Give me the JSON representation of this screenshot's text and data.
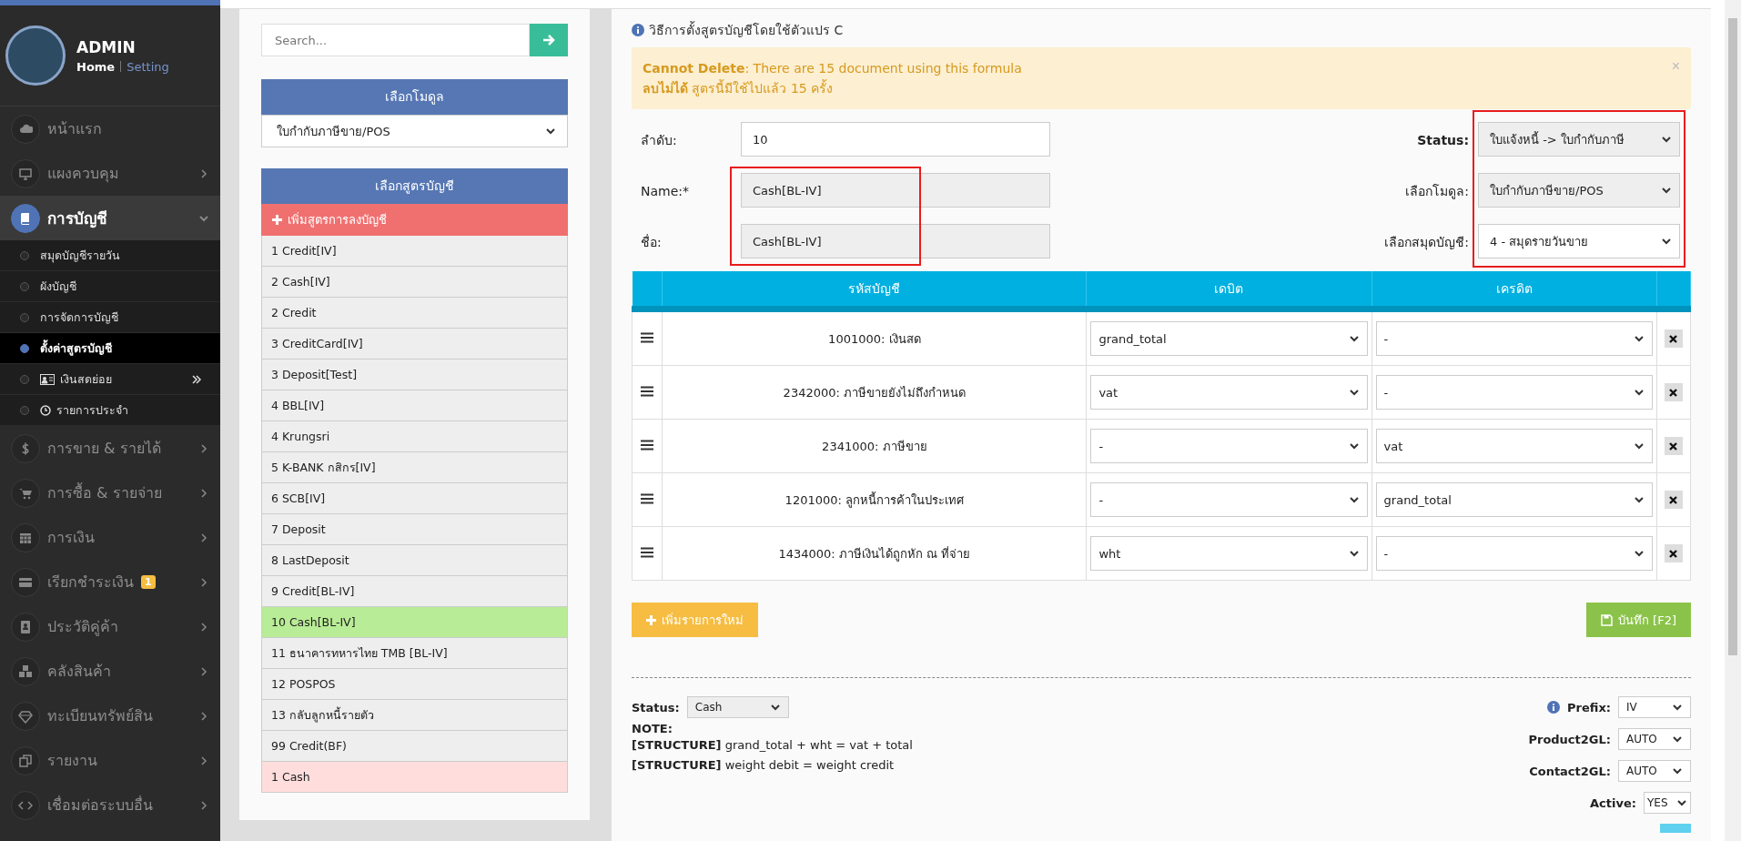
{
  "sidebar": {
    "user": {
      "name": "ADMIN",
      "links": [
        {
          "label": "Home",
          "selected": true
        },
        {
          "label": "Setting",
          "selected": false
        }
      ]
    },
    "items": [
      {
        "label": "หน้าแรก",
        "selected": false,
        "has_arrow": false
      },
      {
        "label": "แผงควบคุม",
        "expanded": false,
        "selected": false,
        "has_arrow": true
      },
      {
        "label": "การบัญชี",
        "expanded": true,
        "selected": true,
        "has_arrow": true,
        "children": [
          {
            "label": "สมุดบัญชีรายวัน",
            "selected": false
          },
          {
            "label": "ผังบัญชี",
            "selected": false
          },
          {
            "label": "การจัดการบัญชี",
            "selected": false
          },
          {
            "label": "ตั้งค่าสูตรบัญชี",
            "selected": true
          },
          {
            "label": "เงินสดย่อย",
            "selected": false
          },
          {
            "label": "รายการประจำ",
            "selected": false
          }
        ]
      },
      {
        "label": "การขาย & รายได้",
        "expanded": false,
        "selected": false,
        "has_arrow": true
      },
      {
        "label": "การซื้อ & รายจ่าย",
        "expanded": false,
        "selected": false,
        "has_arrow": true
      },
      {
        "label": "การเงิน",
        "expanded": false,
        "selected": false,
        "has_arrow": true
      },
      {
        "label": "เรียกชำระเงิน",
        "expanded": false,
        "selected": false,
        "has_arrow": true,
        "badge": "1"
      },
      {
        "label": "ประวัติคู่ค้า",
        "expanded": false,
        "selected": false,
        "has_arrow": true
      },
      {
        "label": "คลังสินค้า",
        "expanded": false,
        "selected": false,
        "has_arrow": true
      },
      {
        "label": "ทะเบียนทรัพย์สิน",
        "expanded": false,
        "selected": false,
        "has_arrow": true
      },
      {
        "label": "รายงาน",
        "expanded": false,
        "selected": false,
        "has_arrow": true
      },
      {
        "label": "เชื่อมต่อระบบอื่น",
        "expanded": false,
        "selected": false,
        "has_arrow": true
      }
    ]
  },
  "formula_panel": {
    "search": {
      "placeholder": "Search..."
    },
    "module": {
      "header": "เลือกโมดูล",
      "value": "ใบกำกับภาษีขาย/POS"
    },
    "formulas": {
      "header": "เลือกสูตรบัญชี",
      "add_button": "เพิ่มสูตรการลงบัญชี",
      "items": [
        {
          "label": "1 Credit[IV]",
          "selected": false,
          "kind": "saved"
        },
        {
          "label": "2 Cash[IV]",
          "selected": false,
          "kind": "saved"
        },
        {
          "label": "2 Credit",
          "selected": false,
          "kind": "saved"
        },
        {
          "label": "3 CreditCard[IV]",
          "selected": false,
          "kind": "saved"
        },
        {
          "label": "3 Deposit[Test]",
          "selected": false,
          "kind": "saved"
        },
        {
          "label": "4 BBL[IV]",
          "selected": false,
          "kind": "saved"
        },
        {
          "label": "4 Krungsri",
          "selected": false,
          "kind": "saved"
        },
        {
          "label": "5 K-BANK กสิกร[IV]",
          "selected": false,
          "kind": "saved"
        },
        {
          "label": "6 SCB[IV]",
          "selected": false,
          "kind": "saved"
        },
        {
          "label": "7 Deposit",
          "selected": false,
          "kind": "saved"
        },
        {
          "label": "8 LastDeposit",
          "selected": false,
          "kind": "saved"
        },
        {
          "label": "9 Credit[BL-IV]",
          "selected": false,
          "kind": "saved"
        },
        {
          "label": "10 Cash[BL-IV]",
          "selected": true,
          "kind": "saved"
        },
        {
          "label": "11 ธนาคารทหารไทย TMB [BL-IV]",
          "selected": false,
          "kind": "saved"
        },
        {
          "label": "12 POSPOS",
          "selected": false,
          "kind": "saved"
        },
        {
          "label": "13 กลับลูกหนี้รายตัว",
          "selected": false,
          "kind": "saved"
        },
        {
          "label": "99 Credit(BF)",
          "selected": false,
          "kind": "saved"
        },
        {
          "label": "1 Cash",
          "selected": false,
          "kind": "draft"
        }
      ]
    }
  },
  "editor": {
    "help_link": "วิธีการตั้งสูตรบัญชีโดยใช้ตัวแปร C",
    "alert": {
      "lines": [
        "**Cannot Delete**: There are 15 document using this formula",
        "**ลบไม่ได้** สูตรนี้มีใช้ไปแล้ว 15 ครั้ง"
      ],
      "close": "×"
    },
    "left_fields": [
      {
        "label": "ลำดับ:",
        "value": "10",
        "disabled": false,
        "highlighted": false
      },
      {
        "label": "Name:*",
        "value": "Cash[BL-IV]",
        "disabled": true,
        "highlighted": true
      },
      {
        "label": "ชื่อ:",
        "value": "Cash[BL-IV]",
        "disabled": true,
        "highlighted": true
      }
    ],
    "right_fields": [
      {
        "label": "Status:",
        "value": "ใบแจ้งหนี้ -> ใบกำกับภาษี",
        "emphasized": true,
        "disabled": true,
        "highlighted": true
      },
      {
        "label": "เลือกโมดูล:",
        "value": "ใบกำกับภาษีขาย/POS",
        "emphasized": false,
        "disabled": true,
        "highlighted": true
      },
      {
        "label": "เลือกสมุดบัญชี:",
        "value": "4 - สมุดรายวันขาย",
        "emphasized": false,
        "disabled": false,
        "highlighted": true
      }
    ],
    "table": {
      "columns": [
        "รหัสบัญชี",
        "เดบิต",
        "เครดิต"
      ],
      "rows": [
        {
          "account": "1001000: เงินสด",
          "debit": "grand_total",
          "credit": "-"
        },
        {
          "account": "2342000: ภาษีขายยังไม่ถึงกำหนด",
          "debit": "vat",
          "credit": "-"
        },
        {
          "account": "2341000: ภาษีขาย",
          "debit": "-",
          "credit": "vat"
        },
        {
          "account": "1201000: ลูกหนี้การค้าในประเทศ",
          "debit": "-",
          "credit": "grand_total"
        },
        {
          "account": "1434000: ภาษีเงินได้ถูกหัก ณ ที่จ่าย",
          "debit": "wht",
          "credit": "-"
        }
      ]
    },
    "add_row_button": "เพิ่มรายการใหม่",
    "save_button": "บันทึก [F2]",
    "footer": {
      "status_label": "Status:",
      "status_value": "Cash",
      "note_title": "NOTE:",
      "notes": [
        "**[STRUCTURE]** grand_total + wht = vat + total",
        "**[STRUCTURE]** weight debit = weight credit"
      ],
      "settings": [
        {
          "label": "Prefix:",
          "value": "IV",
          "info": true
        },
        {
          "label": "Product2GL:",
          "value": "AUTO",
          "info": false
        },
        {
          "label": "Contact2GL:",
          "value": "AUTO",
          "info": false
        },
        {
          "label": "Active:",
          "value": "YES",
          "info": false
        }
      ]
    }
  }
}
